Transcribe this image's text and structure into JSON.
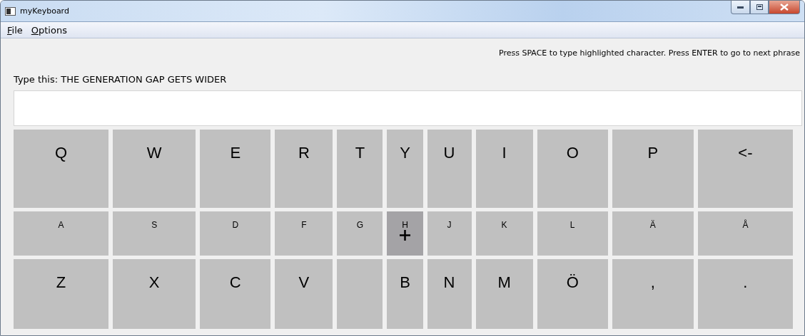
{
  "window": {
    "title": "myKeyboard"
  },
  "menu": [
    {
      "label": "File"
    },
    {
      "label": "Options"
    }
  ],
  "hint": "Press SPACE to type highlighted character. Press ENTER to go to next phrase",
  "prompt": "Type this: THE GENERATION GAP GETS WIDER",
  "keyboard": {
    "rows": [
      {
        "kind": "large",
        "keys": [
          {
            "label": "Q",
            "selected": false
          },
          {
            "label": "W",
            "selected": false
          },
          {
            "label": "E",
            "selected": false
          },
          {
            "label": "R",
            "selected": false
          },
          {
            "label": "T",
            "selected": false
          },
          {
            "label": "Y",
            "selected": false
          },
          {
            "label": "U",
            "selected": false
          },
          {
            "label": "I",
            "selected": false
          },
          {
            "label": "O",
            "selected": false
          },
          {
            "label": "P",
            "selected": false
          },
          {
            "label": "<-",
            "selected": false
          }
        ]
      },
      {
        "kind": "small",
        "keys": [
          {
            "label": "A",
            "selected": false
          },
          {
            "label": "S",
            "selected": false
          },
          {
            "label": "D",
            "selected": false
          },
          {
            "label": "F",
            "selected": false
          },
          {
            "label": "G",
            "selected": false
          },
          {
            "label": "H",
            "selected": true
          },
          {
            "label": "J",
            "selected": false
          },
          {
            "label": "K",
            "selected": false
          },
          {
            "label": "L",
            "selected": false
          },
          {
            "label": "Ä",
            "selected": false
          },
          {
            "label": "Å",
            "selected": false
          }
        ]
      },
      {
        "kind": "large",
        "keys": [
          {
            "label": "Z",
            "selected": false
          },
          {
            "label": "X",
            "selected": false
          },
          {
            "label": "C",
            "selected": false
          },
          {
            "label": "V",
            "selected": false
          },
          {
            "selected": false
          },
          {
            "label": "B",
            "selected": false
          },
          {
            "label": "N",
            "selected": false
          },
          {
            "label": "M",
            "selected": false
          },
          {
            "label": "Ö",
            "selected": false
          },
          {
            "label": ",",
            "selected": false
          },
          {
            "label": ".",
            "selected": false
          }
        ]
      }
    ]
  }
}
